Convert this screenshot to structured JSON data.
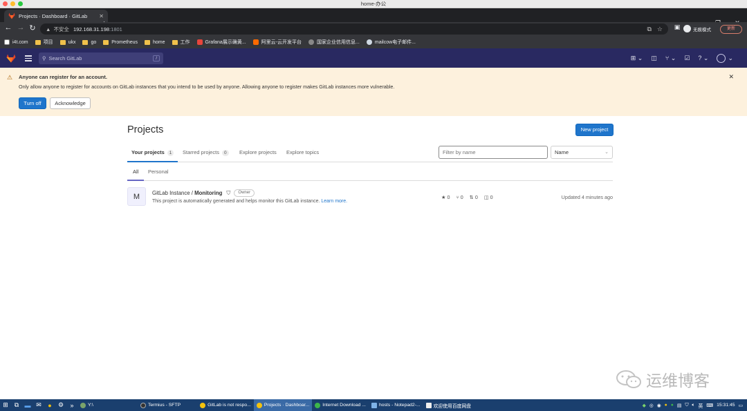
{
  "os_window": {
    "title": "home-办公"
  },
  "browser": {
    "tab_title": "Projects · Dashboard · GitLab",
    "new_tab": "+",
    "address": {
      "security_label": "不安全",
      "host": "192.168.31.198",
      "port": ":1801"
    },
    "profile_label": "无痕模式",
    "update_button": "更新",
    "bookmarks": [
      {
        "label": "i4t.com",
        "icon": "site-icon"
      },
      {
        "label": "项目",
        "icon": "folder-icon"
      },
      {
        "label": "ukx",
        "icon": "folder-icon"
      },
      {
        "label": "go",
        "icon": "folder-icon"
      },
      {
        "label": "Prometheus",
        "icon": "folder-icon"
      },
      {
        "label": "home",
        "icon": "folder-icon"
      },
      {
        "label": "工作",
        "icon": "folder-icon"
      },
      {
        "label": "Grafana展示确黄...",
        "icon": "grafana-icon"
      },
      {
        "label": "阿里云-云开发平台",
        "icon": "aliyun-icon"
      },
      {
        "label": "国家企业信用信息...",
        "icon": "globe-icon"
      },
      {
        "label": "mailcow电子邮件...",
        "icon": "wordpress-icon"
      }
    ]
  },
  "gitlab": {
    "search_placeholder": "Search GitLab",
    "search_shortcut": "/",
    "banner": {
      "title": "Anyone can register for an account.",
      "body": "Only allow anyone to register for accounts on GitLab instances that you intend to be used by anyone. Allowing anyone to register makes GitLab instances more vulnerable.",
      "turn_off": "Turn off",
      "acknowledge": "Acknowledge"
    },
    "page_title": "Projects",
    "new_project": "New project",
    "tabs": [
      {
        "label": "Your projects",
        "count": "1"
      },
      {
        "label": "Starred projects",
        "count": "0"
      },
      {
        "label": "Explore projects"
      },
      {
        "label": "Explore topics"
      }
    ],
    "filter_placeholder": "Filter by name",
    "sort_value": "Name",
    "sub_tabs": [
      "All",
      "Personal"
    ],
    "projects": [
      {
        "avatar_letter": "M",
        "namespace": "GitLab Instance / ",
        "name": "Monitoring",
        "role": "Owner",
        "description": "This project is automatically generated and helps monitor this GitLab instance.",
        "learn_more": "Learn more.",
        "stars": "0",
        "forks": "0",
        "merge_requests": "0",
        "issues": "0",
        "updated": "Updated 4 minutes ago"
      }
    ]
  },
  "watermark": "运维博客",
  "taskbar": {
    "items": [
      {
        "label": "Y:\\",
        "icon": "terminal-icon"
      },
      {
        "label": "Termius - SFTP",
        "icon": "termius-icon"
      },
      {
        "label": "GitLab is not respo...",
        "icon": "chrome-icon"
      },
      {
        "label": "Projects · Dashboar...",
        "icon": "chrome-icon",
        "selected": true
      },
      {
        "label": "Internet Download ...",
        "icon": "idm-icon"
      },
      {
        "label": "hosts - Notepad2-...",
        "icon": "notepad-icon"
      },
      {
        "label": "欢迎使用百度网盘",
        "icon": "baidu-icon"
      }
    ],
    "ime": "英",
    "clock": "15:31:45"
  },
  "colors": {
    "gitlab_header": "#292961",
    "banner_bg": "#fdf1dd",
    "primary": "#1f75cb",
    "taskbar": "#1a3f6e"
  }
}
